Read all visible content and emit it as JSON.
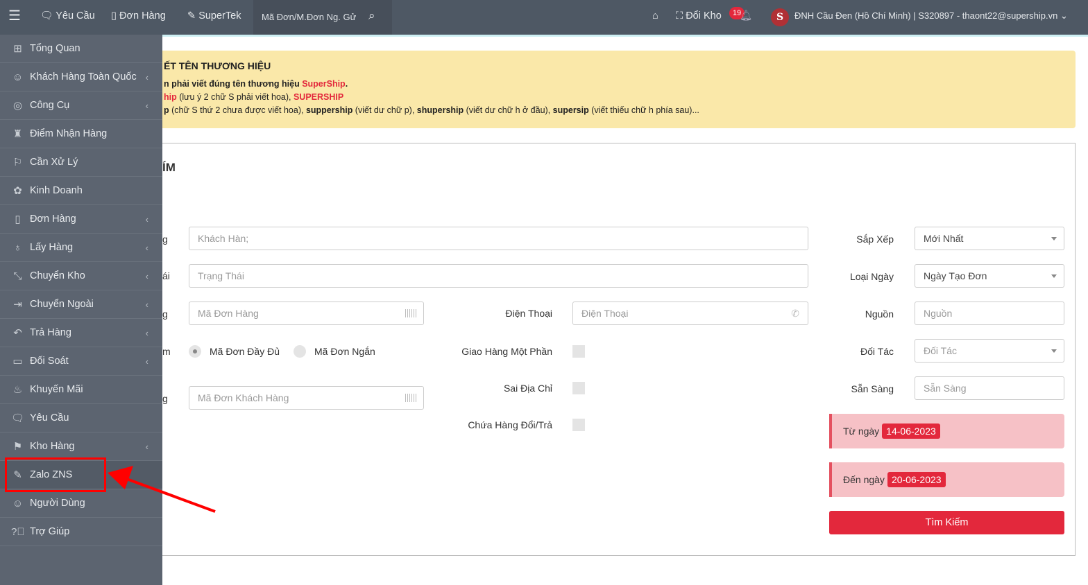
{
  "header": {
    "nav": [
      {
        "label": "Yêu Cầu",
        "icon": "chat-icon"
      },
      {
        "label": "Đơn Hàng",
        "icon": "notebook-icon"
      },
      {
        "label": "SuperTek",
        "icon": "edit-icon"
      }
    ],
    "search_placeholder": "Mã Đơn/M.Đơn Ng. Gử",
    "switch_warehouse": "Đổi Kho",
    "notification_count": "19",
    "user": "ĐNH Cầu Đen (Hồ Chí Minh) | S320897 - thaont22@supership.vn",
    "logo_letter": "S"
  },
  "sidebar": {
    "items": [
      {
        "label": "Tổng Quan",
        "icon": "grid-icon",
        "chev": false
      },
      {
        "label": "Khách Hàng Toàn Quốc",
        "icon": "user-icon",
        "chev": true
      },
      {
        "label": "Công Cụ",
        "icon": "compass-icon",
        "chev": true
      },
      {
        "label": "Điểm Nhận Hàng",
        "icon": "pin-icon",
        "chev": false
      },
      {
        "label": "Cần Xử Lý",
        "icon": "flag-icon",
        "chev": false
      },
      {
        "label": "Kinh Doanh",
        "icon": "palette-icon",
        "chev": false
      },
      {
        "label": "Đơn Hàng",
        "icon": "notebook-icon",
        "chev": true
      },
      {
        "label": "Lấy Hàng",
        "icon": "bulb-icon",
        "chev": true
      },
      {
        "label": "Chuyển Kho",
        "icon": "expand-icon",
        "chev": true
      },
      {
        "label": "Chuyển Ngoài",
        "icon": "login-icon",
        "chev": true
      },
      {
        "label": "Trả Hàng",
        "icon": "reply-icon",
        "chev": true
      },
      {
        "label": "Đối Soát",
        "icon": "wallet-icon",
        "chev": true
      },
      {
        "label": "Khuyến Mãi",
        "icon": "fire-icon",
        "chev": false
      },
      {
        "label": "Yêu Cầu",
        "icon": "chat-icon",
        "chev": false
      },
      {
        "label": "Kho Hàng",
        "icon": "signpost-icon",
        "chev": true
      },
      {
        "label": "Zalo ZNS",
        "icon": "edit-icon",
        "chev": false
      },
      {
        "label": "Người Dùng",
        "icon": "user-icon",
        "chev": false
      },
      {
        "label": "Trợ Giúp",
        "icon": "help-icon",
        "chev": false
      }
    ]
  },
  "notice": {
    "title": "ẾT TÊN THƯƠNG HIỆU",
    "line1a": "n phải viết đúng tên thương hiệu ",
    "line1b": "SuperShip",
    "line1c": ".",
    "line2a": "hip",
    "line2b": " (lưu ý 2 chữ S phải viết hoa), ",
    "line2c": "SUPERSHIP",
    "line3": [
      {
        "t": "p",
        "b": true
      },
      {
        "t": " (chữ S thứ 2 chưa được viết hoa), "
      },
      {
        "t": "suppership",
        "b": true
      },
      {
        "t": " (viết dư chữ p), "
      },
      {
        "t": "shupership",
        "b": true
      },
      {
        "t": " (viết dư chữ h ở đầu), "
      },
      {
        "t": "supersip",
        "b": true
      },
      {
        "t": " (viết thiếu chữ h phía sau)..."
      }
    ]
  },
  "form": {
    "title": "ÍM",
    "cut_labels": [
      "g",
      "ái",
      "g",
      "m",
      "g"
    ],
    "customer_ph": "Khách Hàn;",
    "status_ph": "Trạng Thái",
    "order_code_ph": "Mã Đơn Hàng",
    "phone_label": "Điện Thoại",
    "phone_ph": "Điện Thoại",
    "radio_full": "Mã Đơn Đầy Đủ",
    "radio_short": "Mã Đơn Ngắn",
    "customer_code_ph": "Mã Đơn Khách Hàng",
    "partial": "Giao Hàng Một Phần",
    "wrong_addr": "Sai Địa Chỉ",
    "exchange": "Chứa Hàng Đổi/Trả",
    "sort_label": "Sắp Xếp",
    "sort_value": "Mới Nhất",
    "date_type_label": "Loại Ngày",
    "date_type_value": "Ngày Tạo Đơn",
    "source_label": "Nguồn",
    "source_ph": "Nguồn",
    "partner_label": "Đối Tác",
    "partner_ph": "Đối Tác",
    "ready_label": "Sẵn Sàng",
    "ready_ph": "Sẵn Sàng",
    "from_label": "Từ ngày",
    "from_value": "14-06-2023",
    "to_label": "Đến ngày",
    "to_value": "20-06-2023",
    "search_button": "Tìm Kiếm"
  }
}
